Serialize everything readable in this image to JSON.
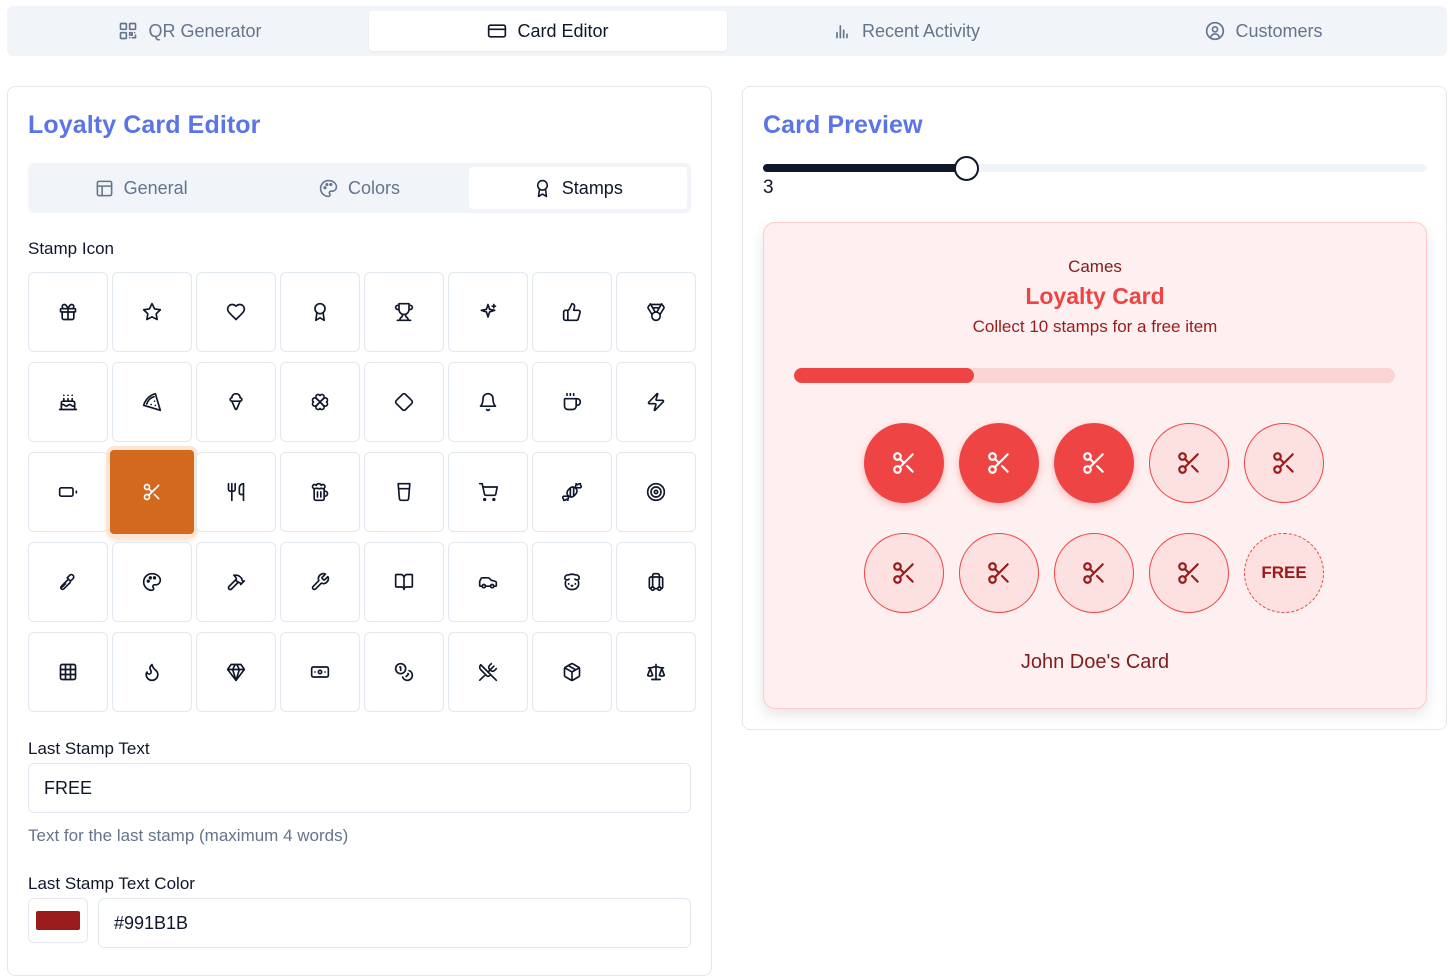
{
  "top_tabs": [
    {
      "label": "QR Generator",
      "icon": "qr-code-icon"
    },
    {
      "label": "Card Editor",
      "icon": "credit-card-icon",
      "active": true
    },
    {
      "label": "Recent Activity",
      "icon": "bar-chart-icon"
    },
    {
      "label": "Customers",
      "icon": "user-circle-icon"
    }
  ],
  "editor": {
    "title": "Loyalty Card Editor",
    "sub_tabs": [
      {
        "label": "General",
        "icon": "layout-icon"
      },
      {
        "label": "Colors",
        "icon": "palette-icon"
      },
      {
        "label": "Stamps",
        "icon": "award-icon",
        "active": true
      }
    ],
    "stamp_icon_label": "Stamp Icon",
    "stamp_icons": [
      "gift",
      "star",
      "heart",
      "award",
      "trophy",
      "sparkles",
      "thumbs-up",
      "medal",
      "cake",
      "pizza",
      "ice-cream",
      "clover",
      "gem-diamond",
      "bell",
      "coffee",
      "zap",
      "battery",
      "scissors",
      "utensils",
      "beer",
      "cup",
      "shopping-cart",
      "candy",
      "target",
      "paintbrush",
      "palette",
      "hammer",
      "wrench",
      "book",
      "car",
      "dog",
      "luggage",
      "grid",
      "flame",
      "diamond",
      "banknote",
      "coins",
      "crossed-utensils",
      "package",
      "scale"
    ],
    "selected_icon": "scissors",
    "last_stamp_text_label": "Last Stamp Text",
    "last_stamp_text_value": "FREE",
    "last_stamp_text_hint": "Text for the last stamp (maximum 4 words)",
    "last_stamp_color_label": "Last Stamp Text Color",
    "last_stamp_color_value": "#991B1B"
  },
  "preview": {
    "title": "Card Preview",
    "slider_value": "3",
    "slider_fraction": 0.305,
    "card": {
      "business": "Cames",
      "title": "Loyalty Card",
      "description": "Collect 10 stamps for a free item",
      "progress": 0.3,
      "total_stamps": 10,
      "filled_stamps": 3,
      "last_stamp_text": "FREE",
      "owner": "John Doe's Card",
      "bg_color": "#fef0f0",
      "accent_color": "#ef4444",
      "text_color": "#991b1b"
    }
  }
}
